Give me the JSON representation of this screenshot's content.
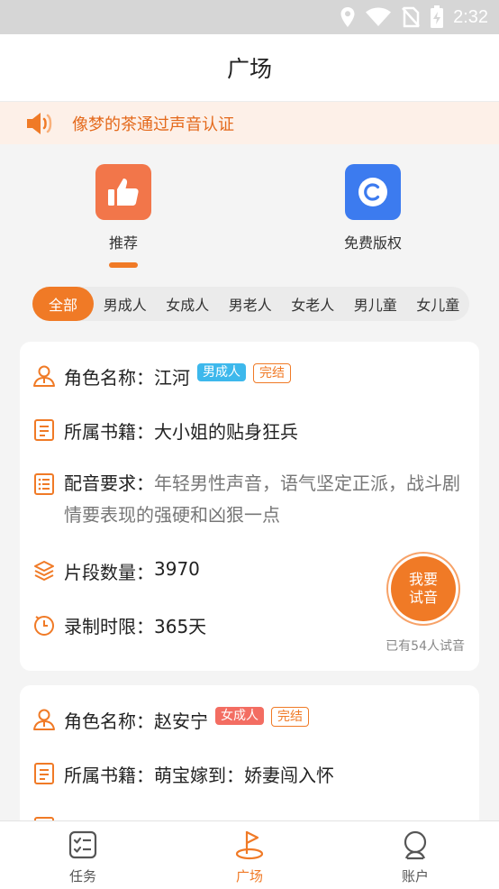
{
  "status_bar": {
    "time": "2:32",
    "icons": [
      "location-icon",
      "wifi-icon",
      "no-sim-icon",
      "battery-charging-icon"
    ]
  },
  "header": {
    "title": "广场"
  },
  "notice": {
    "icon": "speaker-icon",
    "text": "像梦的茶通过声音认证"
  },
  "features": [
    {
      "label": "推荐",
      "icon": "thumbs-up-icon",
      "color": "#f2764a",
      "active": true
    },
    {
      "label": "免费版权",
      "icon": "copyright-icon",
      "color": "#3c7bef",
      "active": false
    }
  ],
  "filters": [
    "全部",
    "男成人",
    "女成人",
    "男老人",
    "女老人",
    "男儿童",
    "女儿童"
  ],
  "active_filter": "全部",
  "cards": [
    {
      "role_label": "角色名称：",
      "role": "江河",
      "tag": "男成人",
      "tag_color": "#3db8ec",
      "status": "完结",
      "book_label": "所属书籍：",
      "book": "大小姐的贴身狂兵",
      "req_label": "配音要求：",
      "requirement": "年轻男性声音，语气坚定正派，战斗剧情要表现的强硬和凶狠一点",
      "count_label": "片段数量：",
      "count": "3970",
      "limit_label": "录制时限：",
      "limit": "365天",
      "audition_button": "我要试音",
      "audition_count": "已有54人试音"
    },
    {
      "role_label": "角色名称：",
      "role": "赵安宁",
      "tag": "女成人",
      "tag_color": "#f36d62",
      "status": "完结",
      "book_label": "所属书籍：",
      "book": "萌宝嫁到：娇妻闯入怀"
    }
  ],
  "tabbar": [
    {
      "label": "任务",
      "icon": "task-list-icon",
      "active": false
    },
    {
      "label": "广场",
      "icon": "flag-icon",
      "active": true
    },
    {
      "label": "账户",
      "icon": "account-icon",
      "active": false
    }
  ],
  "colors": {
    "accent": "#f07a26",
    "notice_bg": "#fdf0e8",
    "status_bar": "#d6d6d6"
  }
}
